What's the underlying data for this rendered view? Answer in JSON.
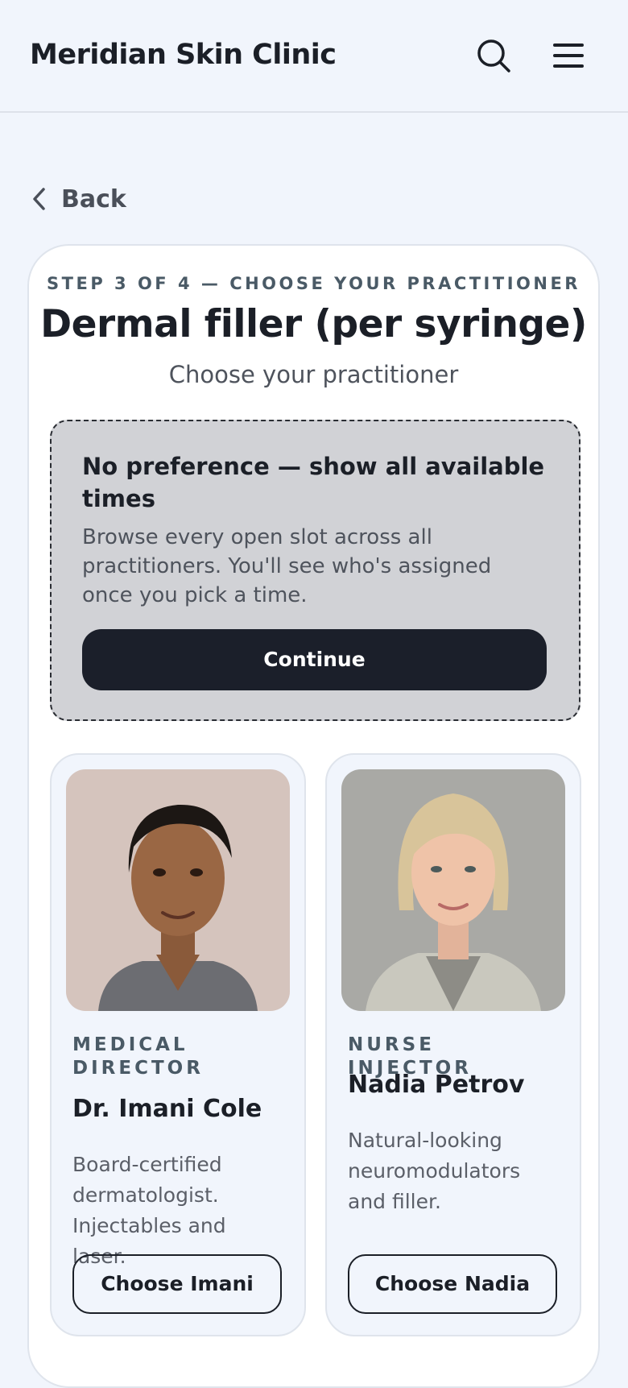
{
  "header": {
    "brand": "Meridian Skin Clinic",
    "search_icon": "search-icon",
    "menu_icon": "hamburger-menu-icon"
  },
  "nav": {
    "back_label": "Back",
    "back_icon": "chevron-left-icon"
  },
  "booking": {
    "step_label": "STEP 3 OF 4 — CHOOSE YOUR PRACTITIONER",
    "service_title": "Dermal filler (per syringe)",
    "subtitle": "Choose your practitioner",
    "no_preference": {
      "title": "No preference — show all available times",
      "description": "Browse every open slot across all practitioners. You'll see who's assigned once you pick a time.",
      "button_label": "Continue"
    },
    "practitioners": [
      {
        "role": "MEDICAL DIRECTOR",
        "name": "Dr. Imani Cole",
        "bio": "Board-certified dermatologist. Injectables and laser.",
        "button_label": "Choose Imani"
      },
      {
        "role": "NURSE INJECTOR",
        "name": "Nadia Petrov",
        "bio": "Natural-looking neuromodulators and filler.",
        "button_label": "Choose Nadia"
      }
    ]
  },
  "colors": {
    "page_bg": "#f1f5fc",
    "card_bg": "#ffffff",
    "primary_button": "#1b1f2a",
    "no_preference_bg": "#d1d2d6",
    "eyebrow_text": "#4a5a66"
  }
}
